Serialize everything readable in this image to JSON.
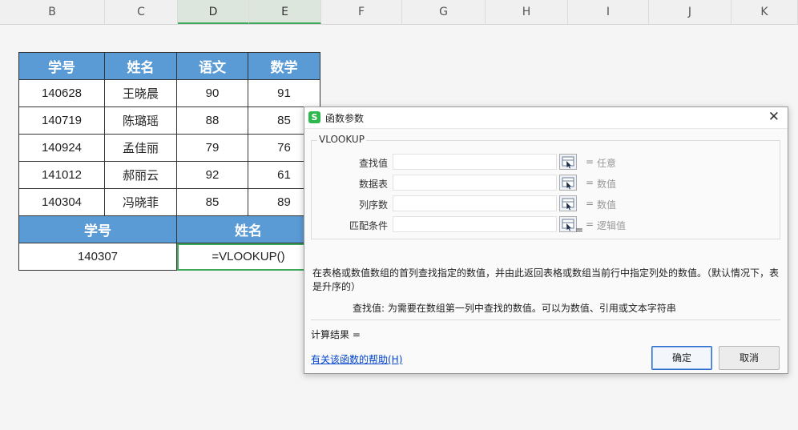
{
  "columns": [
    "B",
    "C",
    "D",
    "E",
    "F",
    "G",
    "H",
    "I",
    "J",
    "K"
  ],
  "table": {
    "headers": [
      "学号",
      "姓名",
      "语文",
      "数学"
    ],
    "rows": [
      [
        "140628",
        "王晓晨",
        "90",
        "91"
      ],
      [
        "140719",
        "陈璐瑶",
        "88",
        "85"
      ],
      [
        "140924",
        "孟佳丽",
        "79",
        "76"
      ],
      [
        "141012",
        "郝丽云",
        "92",
        "61"
      ],
      [
        "140304",
        "冯晓菲",
        "85",
        "89"
      ]
    ],
    "lookup_headers": [
      "学号",
      "姓名"
    ],
    "lookup_id": "140307",
    "formula": "=VLOOKUP()"
  },
  "dialog": {
    "title": "函数参数",
    "logo_text": "S",
    "close_glyph": "✕",
    "function_name": "VLOOKUP",
    "args": [
      {
        "label": "查找值",
        "value": "",
        "hint": "任意"
      },
      {
        "label": "数据表",
        "value": "",
        "hint": "数值"
      },
      {
        "label": "列序数",
        "value": "",
        "hint": "数值"
      },
      {
        "label": "匹配条件",
        "value": "",
        "hint": "逻辑值"
      }
    ],
    "eq_symbol": "=",
    "mid_result": "=",
    "description": "在表格或数值数组的首列查找指定的数值，并由此返回表格或数组当前行中指定列处的数值。（默认情况下，表是升序的）",
    "param_description": "查找值:  为需要在数组第一列中查找的数值。可以为数值、引用或文本字符串",
    "calc_label": "计算结果  =",
    "help_link": "有关该函数的帮助(H)",
    "ok_label": "确定",
    "cancel_label": "取消"
  }
}
